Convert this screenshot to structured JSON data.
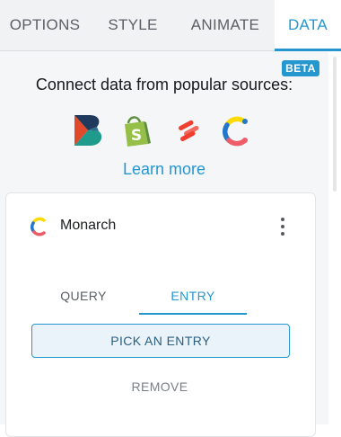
{
  "tabs": [
    {
      "label": "OPTIONS",
      "active": false
    },
    {
      "label": "STYLE",
      "active": false
    },
    {
      "label": "ANIMATE",
      "active": false
    },
    {
      "label": "DATA",
      "active": true
    }
  ],
  "badge": "BETA",
  "headline": "Connect data from popular sources:",
  "sources": [
    {
      "name": "bravo-logo",
      "colors": [
        "#1f3a5c",
        "#e0492a",
        "#1e9b8a"
      ]
    },
    {
      "name": "shopify-logo",
      "colors": [
        "#95bf47",
        "#5e8e3e",
        "#ffffff"
      ]
    },
    {
      "name": "sanity-logo",
      "colors": [
        "#f03e2f"
      ]
    },
    {
      "name": "contentful-logo",
      "colors": [
        "#2478cc",
        "#ffda00",
        "#ed5c68"
      ]
    }
  ],
  "learn_more": "Learn more",
  "connection": {
    "name": "Monarch",
    "subtabs": [
      {
        "label": "QUERY",
        "active": false
      },
      {
        "label": "ENTRY",
        "active": true
      }
    ],
    "pick_label": "PICK AN ENTRY",
    "remove_label": "REMOVE"
  },
  "colors": {
    "accent": "#2497cf",
    "tab_bg": "#f1f2f4",
    "panel_bg": "#f5f6f7"
  }
}
